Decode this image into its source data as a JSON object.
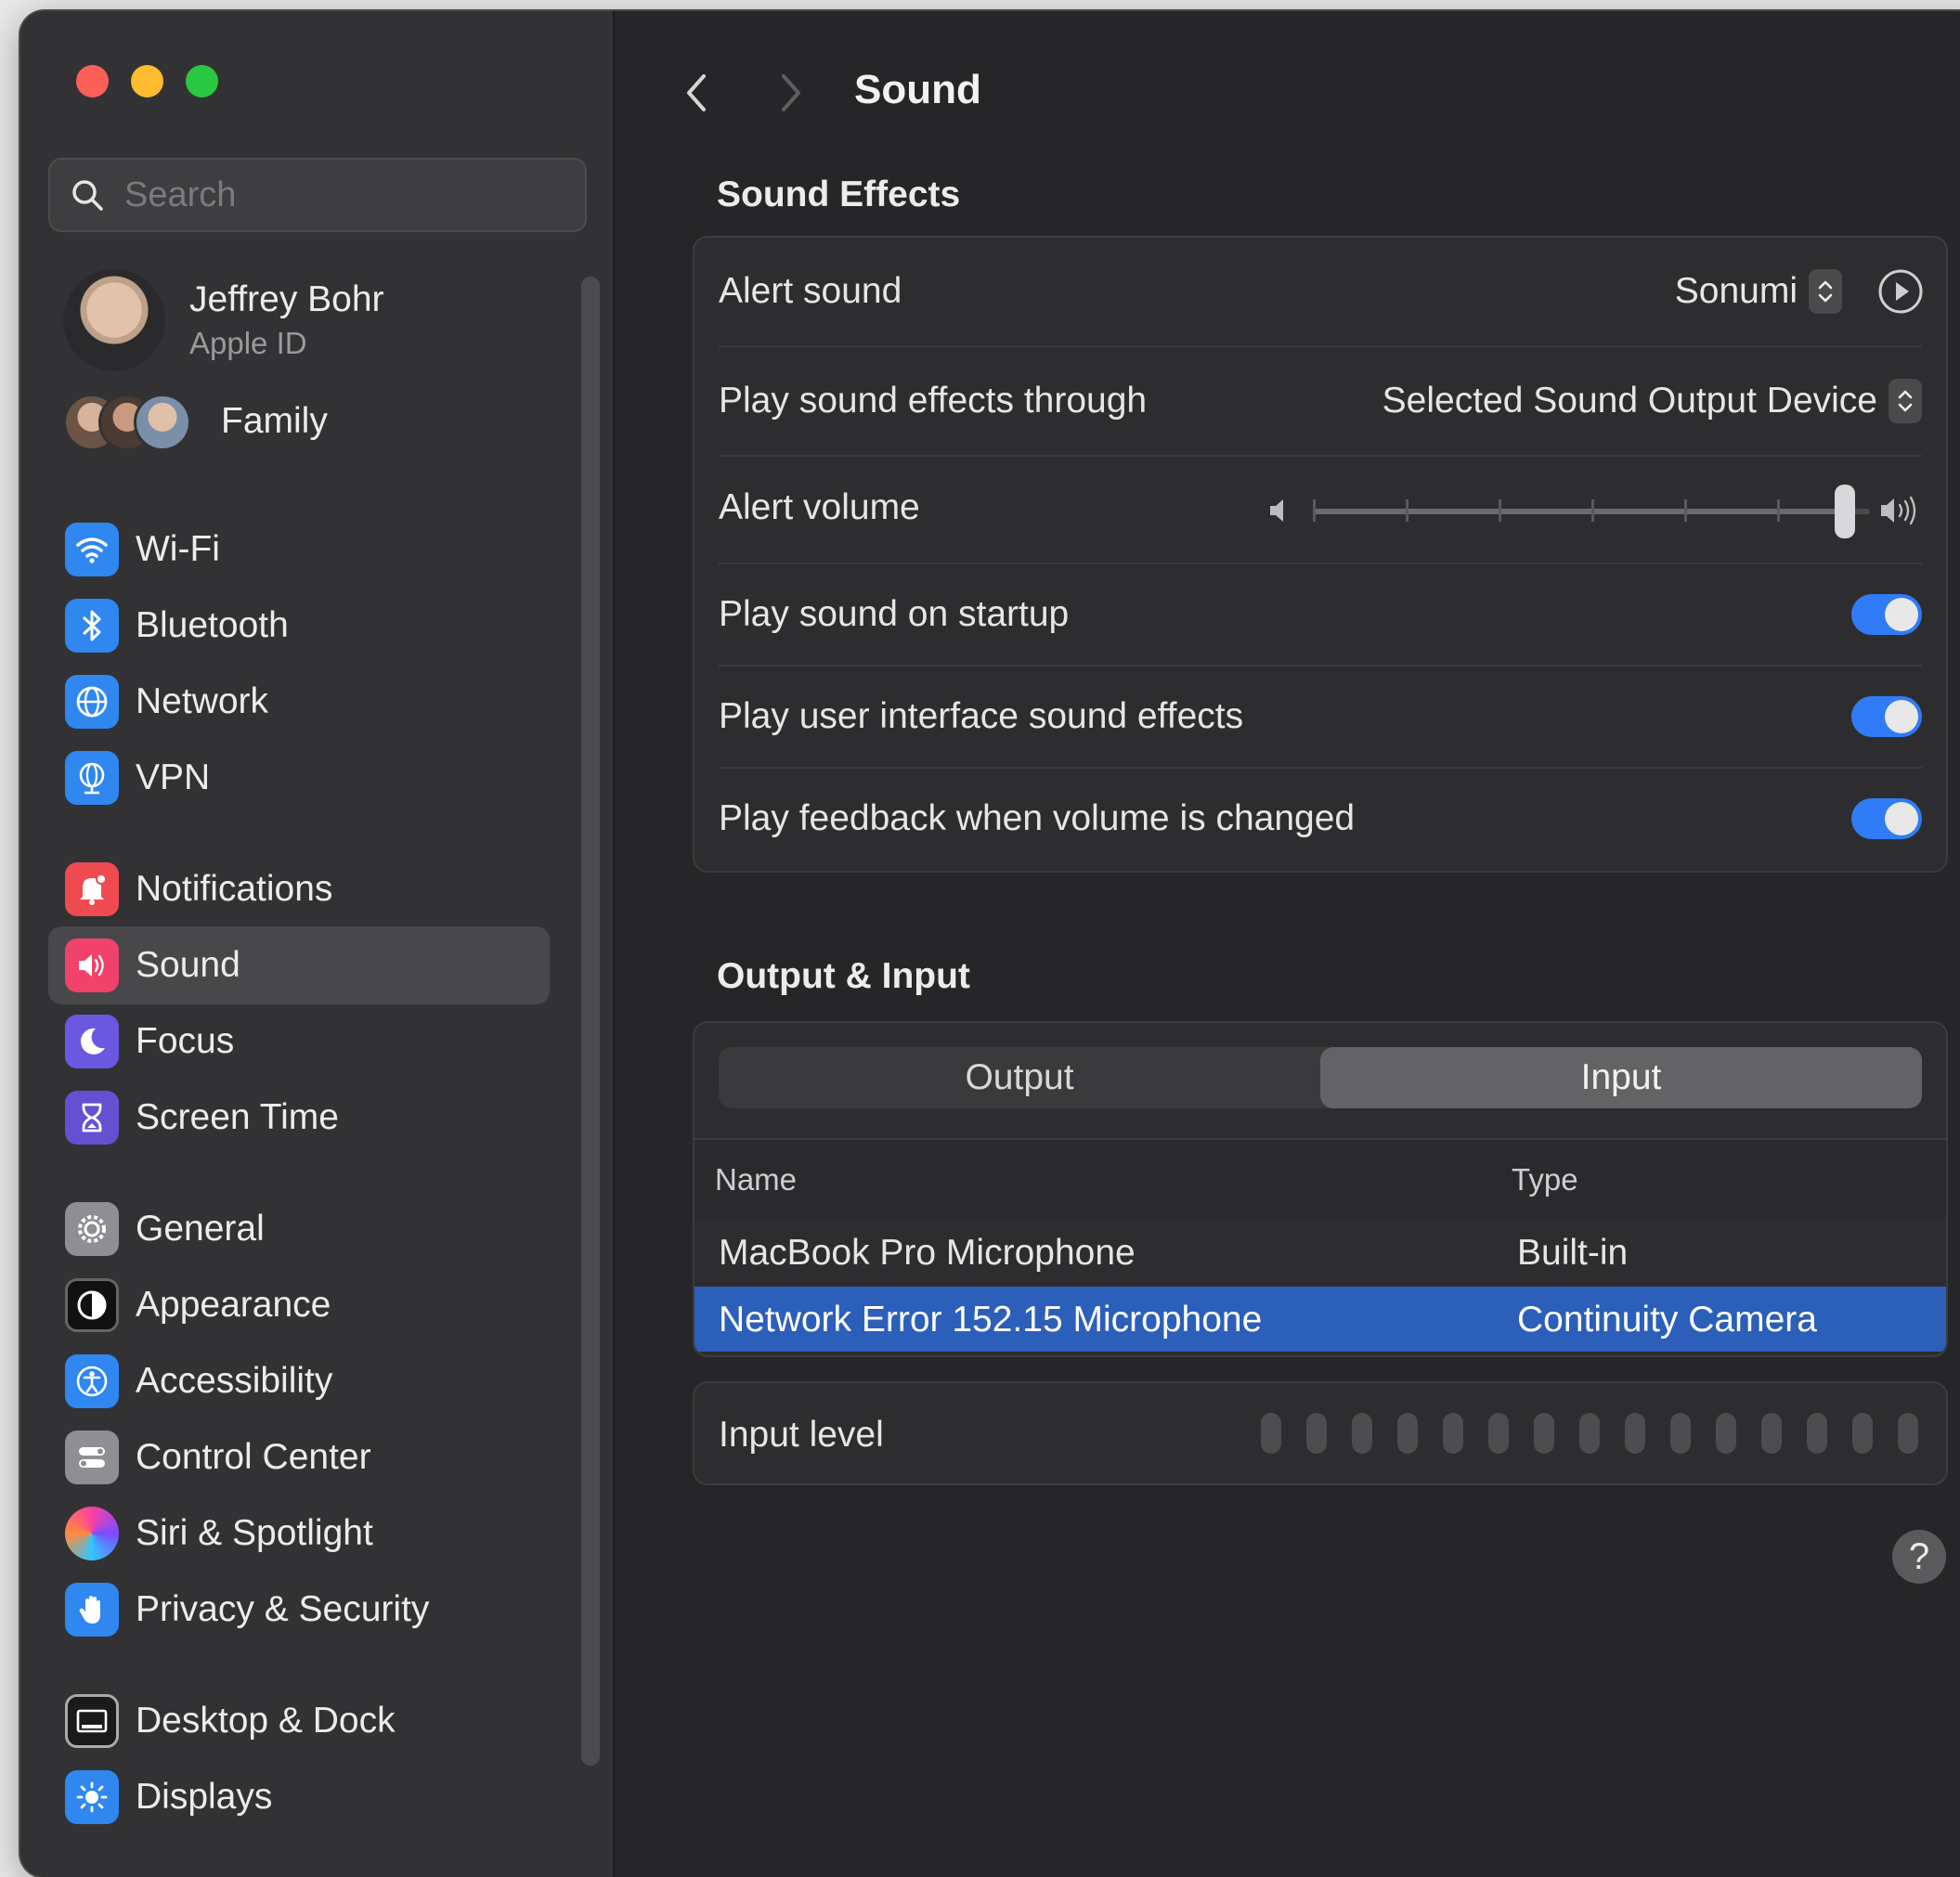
{
  "window": {
    "colors": {
      "close": "#fe5f57",
      "minimize": "#febc2e",
      "zoom": "#28c840",
      "accent": "#2f7cf6",
      "selection": "#2c5fba"
    }
  },
  "search": {
    "placeholder": "Search",
    "value": ""
  },
  "profile": {
    "name": "Jeffrey Bohr",
    "subtitle": "Apple ID"
  },
  "family": {
    "label": "Family"
  },
  "sidebar": {
    "items": [
      {
        "label": "Wi-Fi",
        "icon": "wifi-icon",
        "selected": false
      },
      {
        "label": "Bluetooth",
        "icon": "bluetooth-icon",
        "selected": false
      },
      {
        "label": "Network",
        "icon": "globe-icon",
        "selected": false
      },
      {
        "label": "VPN",
        "icon": "vpn-globe-icon",
        "selected": false
      },
      {
        "label": "Notifications",
        "icon": "bell-icon",
        "selected": false
      },
      {
        "label": "Sound",
        "icon": "speaker-icon",
        "selected": true
      },
      {
        "label": "Focus",
        "icon": "moon-icon",
        "selected": false
      },
      {
        "label": "Screen Time",
        "icon": "hourglass-icon",
        "selected": false
      },
      {
        "label": "General",
        "icon": "gear-icon",
        "selected": false
      },
      {
        "label": "Appearance",
        "icon": "appearance-icon",
        "selected": false
      },
      {
        "label": "Accessibility",
        "icon": "accessibility-icon",
        "selected": false
      },
      {
        "label": "Control Center",
        "icon": "switches-icon",
        "selected": false
      },
      {
        "label": "Siri & Spotlight",
        "icon": "siri-icon",
        "selected": false
      },
      {
        "label": "Privacy & Security",
        "icon": "hand-icon",
        "selected": false
      },
      {
        "label": "Desktop & Dock",
        "icon": "dock-icon",
        "selected": false
      },
      {
        "label": "Displays",
        "icon": "brightness-icon",
        "selected": false
      }
    ]
  },
  "main": {
    "title": "Sound",
    "sound_effects": {
      "heading": "Sound Effects",
      "alert_sound": {
        "label": "Alert sound",
        "value": "Sonumi"
      },
      "play_through": {
        "label": "Play sound effects through",
        "value": "Selected Sound Output Device"
      },
      "alert_volume": {
        "label": "Alert volume",
        "level_fraction": 1.0
      },
      "startup": {
        "label": "Play sound on startup",
        "on": true
      },
      "ui_effects": {
        "label": "Play user interface sound effects",
        "on": true
      },
      "feedback": {
        "label": "Play feedback when volume is changed",
        "on": true
      }
    },
    "output_input": {
      "heading": "Output & Input",
      "tabs": [
        "Output",
        "Input"
      ],
      "active_tab": "Input",
      "columns": [
        "Name",
        "Type"
      ],
      "rows": [
        {
          "name": "MacBook Pro Microphone",
          "type": "Built-in",
          "selected": false
        },
        {
          "name": "Network Error 152.15 Microphone",
          "type": "Continuity Camera",
          "selected": true
        }
      ],
      "input_level": {
        "label": "Input level",
        "level_fraction": 0.0
      }
    },
    "help": "?"
  }
}
